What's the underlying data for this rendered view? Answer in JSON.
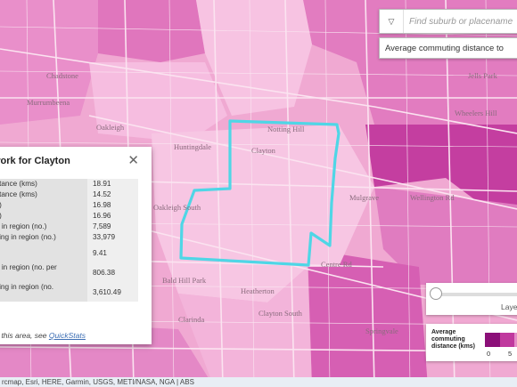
{
  "search": {
    "placeholder": "Find suburb or placename",
    "dropdown_icon": "chevron-down-icon"
  },
  "layer_select": {
    "value": "Average commuting distance to"
  },
  "popup": {
    "title": "work for Clayton",
    "close_icon": "close-icon",
    "rows": [
      {
        "label": "stance (kms)",
        "value": "18.91"
      },
      {
        "label": "stance (kms)",
        "value": "14.52"
      },
      {
        "label": "s)",
        "value": "16.98"
      },
      {
        "label": "s)",
        "value": "16.96"
      },
      {
        "label": "g in region (no.)",
        "value": "7,589"
      },
      {
        "label": "cing in region (no.)",
        "value": "33,979"
      },
      {
        "label": "",
        "value": "9.41"
      },
      {
        "label": "g in region (no. per",
        "value": "806.38"
      },
      {
        "label": "cing in region (no.",
        "value": "3,610.49"
      }
    ],
    "footer_prefix": "ut this area, see ",
    "footer_link": "QuickStats"
  },
  "slider": {
    "label": "Laye",
    "value": 0
  },
  "legend": {
    "title": "Average commuting distance (kms)",
    "colors": [
      "#8b0f78",
      "#c0399e",
      "#e58cc7"
    ],
    "ticks": [
      "0",
      "5"
    ]
  },
  "map_labels": {
    "chadstone": "Chadstone",
    "murrumbeena": "Murrumbeena",
    "oakleigh": "Oakleigh",
    "huntingdale": "Huntingdale",
    "oakleigh_south": "Oakleigh South",
    "huntingdale_road": "Huntingdale Rd",
    "clayton": "Clayton",
    "mulgrave": "Mulgrave",
    "wellington_rd": "Wellington Rd",
    "notting_hill": "Notting Hill",
    "clayton_south": "Clayton South",
    "heatherton": "Heatherton",
    "dingley_village": "Dingley Village",
    "clarinda": "Clarinda",
    "springvale": "Springvale",
    "jells_park": "Jells Park",
    "wheelers_hill": "Wheelers Hill",
    "bald_hill_park": "Bald Hill Park",
    "centre_rd": "Centre Rd"
  },
  "selection_color": "#4fd6e6",
  "attribution": "rcmap, Esri, HERE, Garmin, USGS, METI/NASA, NGA | ABS"
}
